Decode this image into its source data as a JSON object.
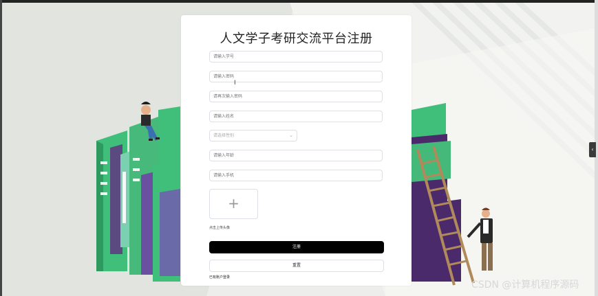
{
  "form": {
    "title": "人文学子考研交流平台注册",
    "fields": [
      {
        "placeholder": "请输入学号"
      },
      {
        "placeholder": "请输入密码"
      },
      {
        "placeholder": "请再次输入密码"
      },
      {
        "placeholder": "请输入姓名"
      },
      {
        "placeholder": "请输入年龄"
      },
      {
        "placeholder": "请输入手机"
      }
    ],
    "gender_select": {
      "placeholder": "请选择性别"
    },
    "upload": {
      "plus": "+",
      "hint": "点击上传头像"
    },
    "register_button": "注册",
    "reset_button": "重置",
    "login_link": "已有账户登录"
  },
  "colors": {
    "primary_button": "#000000",
    "book_green": "#3fbf7a",
    "book_purple": "#5a2a6b"
  },
  "side_tab": {
    "glyph": "‹"
  },
  "watermark": "CSDN @计算机程序源码"
}
